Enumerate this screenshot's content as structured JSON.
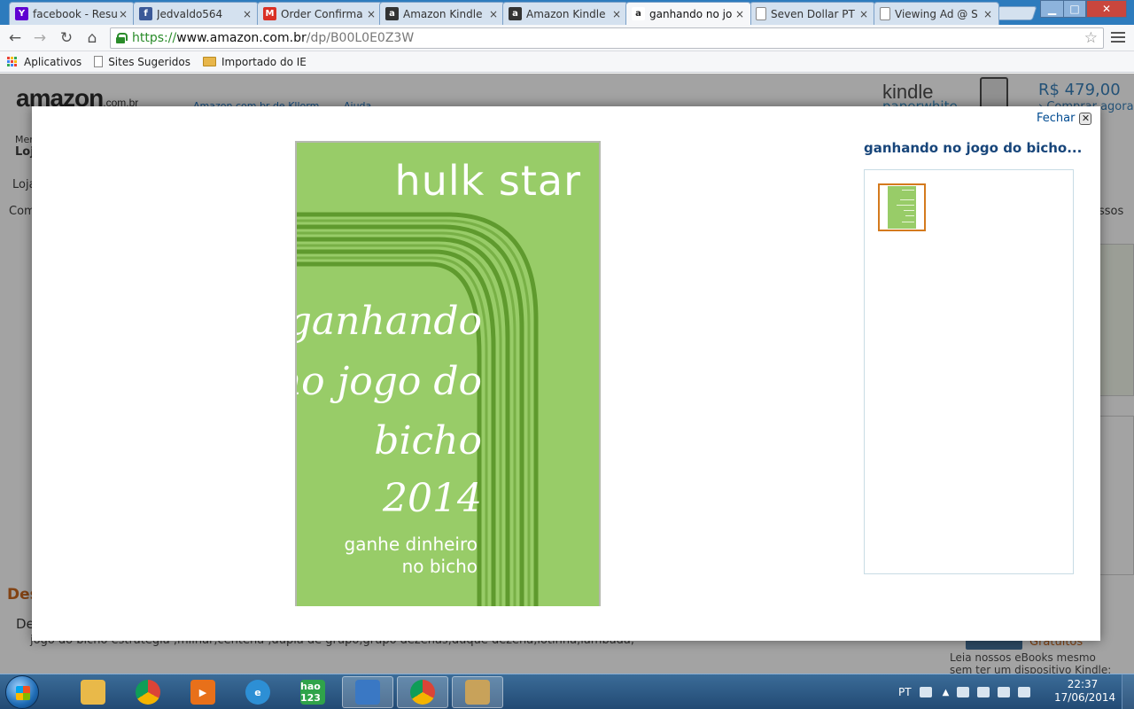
{
  "browser": {
    "tabs": [
      {
        "title": "facebook - Resu",
        "icon": "yahoo-icon",
        "color": "#5f01d1",
        "glyph": "Y",
        "active": false
      },
      {
        "title": "Jedvaldo564",
        "icon": "facebook-icon",
        "color": "#3b5998",
        "glyph": "f",
        "active": false
      },
      {
        "title": "Order Confirma",
        "icon": "gmail-icon",
        "color": "#d93025",
        "glyph": "M",
        "active": false
      },
      {
        "title": "Amazon Kindle",
        "icon": "amazon-icon",
        "color": "#333333",
        "glyph": "a",
        "active": false
      },
      {
        "title": "Amazon Kindle",
        "icon": "amazon-icon",
        "color": "#333333",
        "glyph": "a",
        "active": false
      },
      {
        "title": "ganhando no jo",
        "icon": "amazon-icon",
        "color": "#ffffff",
        "glyph": "a",
        "active": true
      },
      {
        "title": "Seven Dollar PT",
        "icon": "page-icon",
        "color": "#ffffff",
        "glyph": "",
        "active": false
      },
      {
        "title": "Viewing Ad @ S",
        "icon": "page-icon",
        "color": "#ffffff",
        "glyph": "",
        "active": false
      }
    ],
    "tab_close_glyph": "×",
    "url": {
      "scheme": "https://",
      "host": "www.amazon.com.br",
      "path": "/dp/B00L0E0Z3W"
    },
    "bookmarks": [
      {
        "label": "Aplicativos",
        "icon": "apps-icon"
      },
      {
        "label": "Sites Sugeridos",
        "icon": "page-icon"
      },
      {
        "label": "Importado do IE",
        "icon": "folder-icon"
      }
    ]
  },
  "page": {
    "logo": "amazon",
    "logo_tld": ".com.br",
    "header_link_1": "Amazon.com.br de Kllorm",
    "header_link_2": "Ajuda",
    "kindle_ad_title": "kindle",
    "kindle_ad_sub": "paperwhite",
    "kindle_price": "R$ 479,00",
    "kindle_buy": "› Comprar agora",
    "nav_label_1": "Men",
    "nav_label_2": "Loj",
    "subnav_label": "Loja",
    "breadcrumb_label": "Com",
    "right_edge_text": "ssos",
    "desc_head": "Des",
    "desc_sub": "De",
    "desc_text": "jogo do bicho estrategia ,milhar,centena ,dupla de grupo,grupo dezenas,duque dezena,lotinha,lambada,",
    "sidebox_free_title": "Gratuitos",
    "sidebox_free_text": "Leia nossos eBooks mesmo sem ter um dispositivo Kindle: basta"
  },
  "modal": {
    "close_label": "Fechar",
    "close_glyph": "✕",
    "title": "ganhando no jogo do bicho...",
    "cover": {
      "author": "hulk star",
      "title_lines": [
        "ganhando",
        "no jogo do",
        "bicho",
        "2014"
      ],
      "subtitle_lines": [
        "ganhe dinheiro",
        "no bicho"
      ]
    }
  },
  "taskbar": {
    "items": [
      {
        "name": "explorer-icon",
        "color": "#e9b949",
        "glyph": "",
        "active": false
      },
      {
        "name": "chrome-icon",
        "color": "#db4437",
        "glyph": "",
        "active": false
      },
      {
        "name": "media-player-icon",
        "color": "#e8701a",
        "glyph": "▶",
        "active": false
      },
      {
        "name": "ie-icon",
        "color": "#2d8fd5",
        "glyph": "e",
        "active": false
      },
      {
        "name": "hao123-icon",
        "color": "#2fa34a",
        "glyph": "hao 123",
        "active": false
      },
      {
        "name": "app-window-icon",
        "color": "#3a78c4",
        "glyph": "",
        "active": true
      },
      {
        "name": "chrome-icon",
        "color": "#db4437",
        "glyph": "",
        "active": true
      },
      {
        "name": "paint-icon",
        "color": "#c8a25a",
        "glyph": "",
        "active": true
      }
    ],
    "language": "PT",
    "time": "22:37",
    "date": "17/06/2014"
  }
}
